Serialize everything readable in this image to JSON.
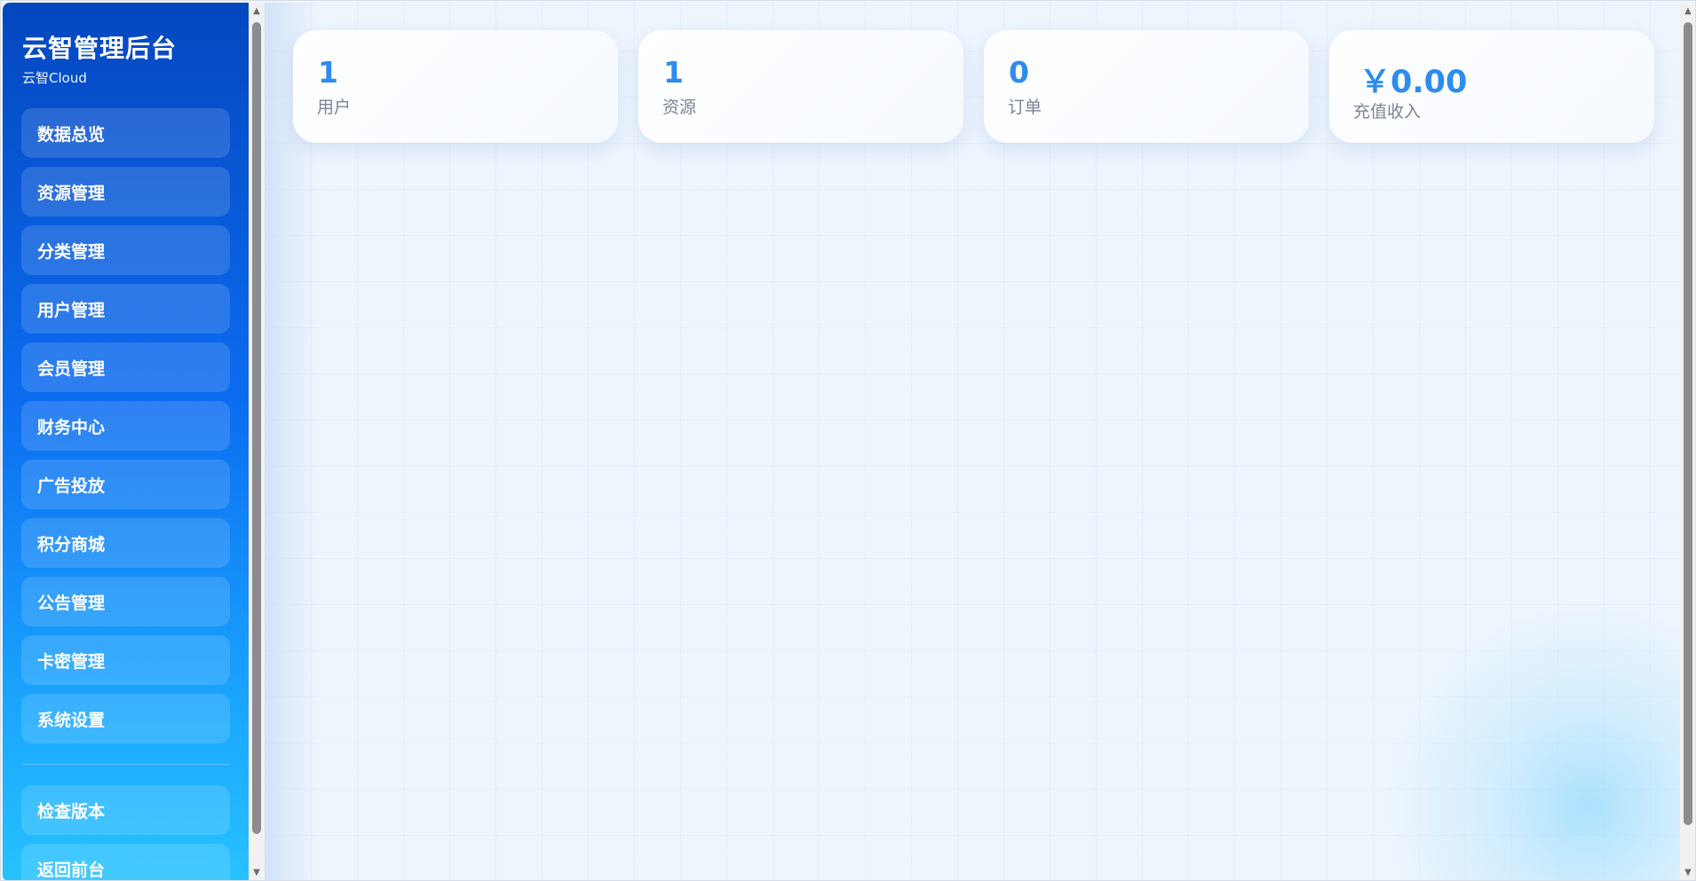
{
  "sidebar": {
    "title": "云智管理后台",
    "subtitle": "云智Cloud",
    "items": [
      {
        "label": "数据总览"
      },
      {
        "label": "资源管理"
      },
      {
        "label": "分类管理"
      },
      {
        "label": "用户管理"
      },
      {
        "label": "会员管理"
      },
      {
        "label": "财务中心"
      },
      {
        "label": "广告投放"
      },
      {
        "label": "积分商城"
      },
      {
        "label": "公告管理"
      },
      {
        "label": "卡密管理"
      },
      {
        "label": "系统设置"
      }
    ],
    "bottom_items": [
      {
        "label": "检查版本"
      },
      {
        "label": "返回前台"
      }
    ]
  },
  "stats": [
    {
      "value": "1",
      "label": "用户"
    },
    {
      "value": "1",
      "label": "资源"
    },
    {
      "value": "0",
      "label": "订单"
    },
    {
      "value": "￥0.00",
      "label": "充值收入"
    }
  ],
  "colors": {
    "accent": "#2d8cf0",
    "sidebar_top": "#0447bf",
    "sidebar_bottom": "#27c2ff",
    "label": "#7b8594"
  },
  "icons": {
    "scroll_up": "▲",
    "scroll_down": "▼"
  }
}
